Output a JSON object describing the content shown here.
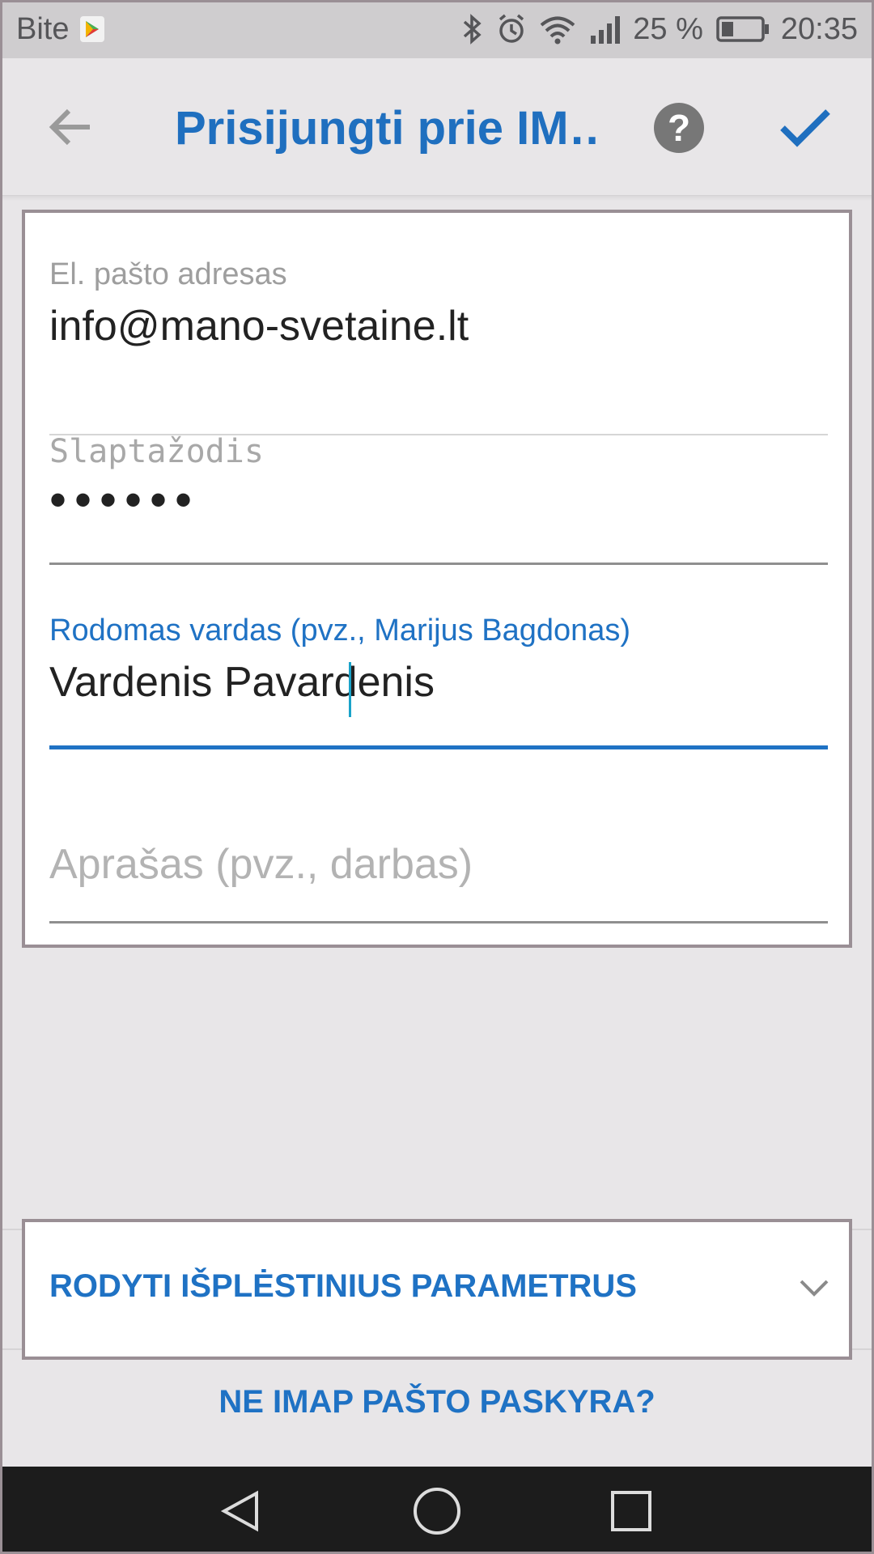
{
  "status_bar": {
    "carrier": "Bite",
    "battery_percent": "25 %",
    "time": "20:35",
    "icons": [
      "play-store-icon",
      "bluetooth-icon",
      "alarm-icon",
      "wifi-icon",
      "signal-icon",
      "battery-icon"
    ]
  },
  "toolbar": {
    "title": "Prisijungti prie IM…",
    "back_icon": "back-arrow-icon",
    "help_label": "?",
    "done_icon": "check-icon"
  },
  "form": {
    "email": {
      "label": "El. pašto adresas",
      "value": "info@mano-svetaine.lt"
    },
    "password": {
      "label": "Slaptažodis",
      "value": "••••••"
    },
    "display_name": {
      "label": "Rodomas vardas (pvz., Marijus Bagdonas)",
      "value": "Vardenis Pavardenis"
    },
    "description": {
      "placeholder": "Aprašas (pvz., darbas)",
      "value": ""
    }
  },
  "advanced": {
    "label": "RODYTI IŠPLĖSTINIUS PARAMETRUS",
    "icon": "chevron-down-icon"
  },
  "non_imap_link": "NE IMAP PAŠTO PASKYRA?",
  "colors": {
    "accent": "#1f72c4",
    "background": "#e8e6e8",
    "navbar": "#1c1c1c"
  }
}
